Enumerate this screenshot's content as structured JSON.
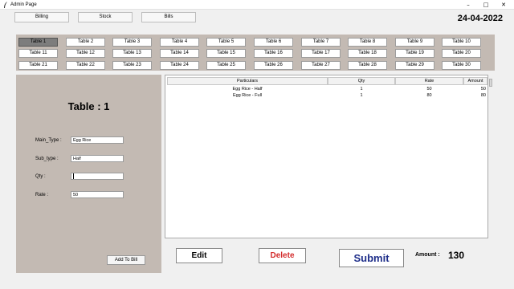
{
  "window": {
    "title": "Admin Page"
  },
  "menu": {
    "billing": "Billing",
    "stock": "Stock",
    "bills": "Bills"
  },
  "date": "24-04-2022",
  "tables": [
    "Table 1",
    "Table 2",
    "Table 3",
    "Table 4",
    "Table 5",
    "Table 6",
    "Table 7",
    "Table 8",
    "Table 9",
    "Table 10",
    "Table 11",
    "Table 12",
    "Table 13",
    "Table 14",
    "Table 15",
    "Table 16",
    "Table 17",
    "Table 18",
    "Table 19",
    "Table 20",
    "Table 21",
    "Table 22",
    "Table 23",
    "Table 24",
    "Table 25",
    "Table 26",
    "Table 27",
    "Table 28",
    "Table 29",
    "Table 30"
  ],
  "selected_table": "Table 1",
  "form": {
    "heading": "Table :  1",
    "main_type_label": "Main_Type :",
    "main_type_value": "Egg Rice",
    "sub_type_label": "Sub_type :",
    "sub_type_value": "Half",
    "qty_label": "Qty :",
    "qty_value": "",
    "rate_label": "Rate :",
    "rate_value": "50",
    "add_button": "Add To Bill"
  },
  "order_table": {
    "columns": [
      "Particulars",
      "Qty",
      "Rate",
      "Amount"
    ],
    "rows": [
      [
        "Egg Rice - Half",
        "1",
        "50",
        "50"
      ],
      [
        "Egg Rice - Full",
        "1",
        "80",
        "80"
      ]
    ]
  },
  "actions": {
    "edit": "Edit",
    "delete": "Delete",
    "submit": "Submit"
  },
  "colors": {
    "delete_text": "#d32b2b",
    "submit_text": "#1f2f8a",
    "panel_bg": "#c3bab3"
  },
  "total": {
    "label": "Amount :",
    "value": "130"
  }
}
